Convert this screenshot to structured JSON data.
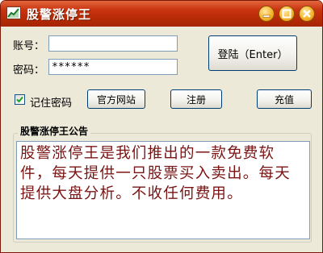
{
  "window": {
    "title": "股警涨停王",
    "colors": {
      "titlebar": "#b62a05",
      "notice_text": "#7a1414"
    },
    "icons": [
      "chart-icon",
      "minimize-icon",
      "maximize-icon",
      "close-icon"
    ]
  },
  "login": {
    "account_label": "账号：",
    "account_value": "",
    "password_label": "密码：",
    "password_value": "******",
    "login_button": "登陆（Enter）",
    "remember_label": "记住密码",
    "remember_checked": true,
    "official_site_button": "官方网站",
    "register_button": "注册",
    "recharge_button": "充值"
  },
  "announcement": {
    "title": "股警涨停王公告",
    "text": "股警涨停王是我们推出的一款免费软件，每天提供一只股票买入卖出。每天提供大盘分析。不收任何费用。"
  }
}
